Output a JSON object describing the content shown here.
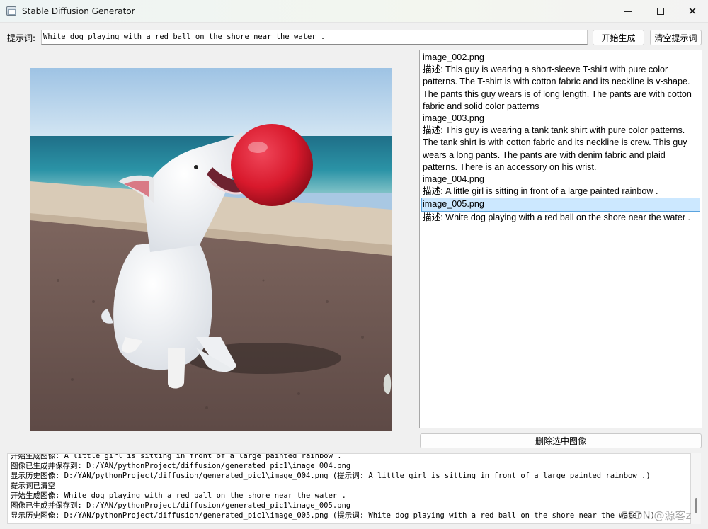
{
  "window": {
    "title": "Stable Diffusion Generator",
    "icon": "app-window-icon"
  },
  "prompt": {
    "label": "提示词:",
    "value": "White dog playing with a red ball on the shore near the water ."
  },
  "toolbar": {
    "generate_label": "开始生成",
    "clear_label": "清空提示词"
  },
  "image": {
    "description": "White dog playing with a red ball on the shore near the water ."
  },
  "history": {
    "items": [
      {
        "file": "image_002.png",
        "desc": "描述: This guy is wearing a short-sleeve T-shirt with pure color patterns. The T-shirt is with cotton fabric and its neckline is v-shape. The pants this guy wears is of long length. The pants are with cotton fabric and solid color patterns"
      },
      {
        "file": "image_003.png",
        "desc": "描述: This guy is wearing a tank tank shirt with pure color patterns. The tank shirt is with cotton fabric and its neckline is crew. This guy wears a long pants. The pants are with denim fabric and plaid patterns. There is an accessory on his wrist."
      },
      {
        "file": "image_004.png",
        "desc": "描述: A little girl is sitting in front of a large painted rainbow ."
      },
      {
        "file": "image_005.png",
        "desc": "描述: White dog playing with a red ball on the shore near the water .",
        "selected": true
      }
    ],
    "delete_label": "删除选中图像"
  },
  "log": {
    "lines": [
      "开始生成图像: A little girl is sitting in front of a large painted rainbow .",
      "图像已生成并保存到: D:/YAN/pythonProject/diffusion/generated_pic1\\image_004.png",
      "显示历史图像: D:/YAN/pythonProject/diffusion/generated_pic1\\image_004.png (提示词: A little girl is sitting in front of a large painted rainbow .)",
      "提示词已清空",
      "开始生成图像: White dog playing with a red ball on the shore near the water .",
      "图像已生成并保存到: D:/YAN/pythonProject/diffusion/generated_pic1\\image_005.png",
      "显示历史图像: D:/YAN/pythonProject/diffusion/generated_pic1\\image_005.png (提示词: White dog playing with a red ball on the shore near the water .)"
    ]
  },
  "watermark": "CSDN @源客z",
  "colors": {
    "selection_bg": "#cce8ff",
    "selection_border": "#5aa3de",
    "ball_red": "#d8192c"
  }
}
